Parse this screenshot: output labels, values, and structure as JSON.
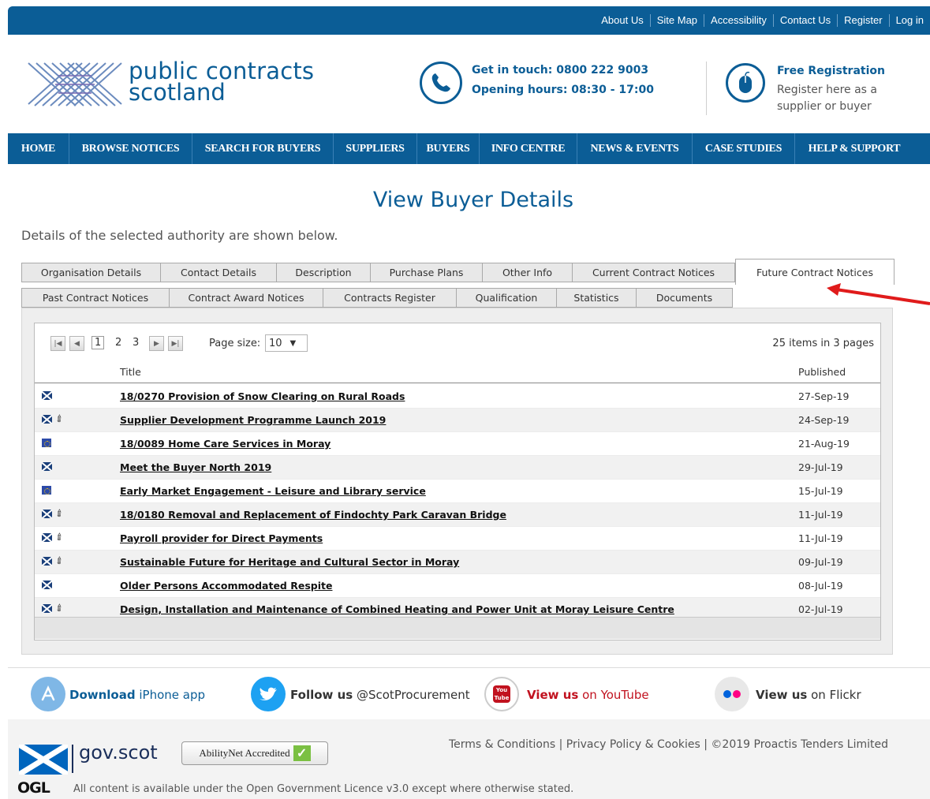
{
  "top_links": [
    "About Us",
    "Site Map",
    "Accessibility",
    "Contact Us",
    "Register",
    "Log in"
  ],
  "logo": {
    "line1": "public contracts",
    "line2": "scotland"
  },
  "contact": {
    "line1": "Get in touch: 0800 222 9003",
    "line2": "Opening hours: 08:30 - 17:00"
  },
  "registration": {
    "title": "Free Registration",
    "line1": "Register here as a",
    "line2": "supplier or buyer"
  },
  "nav": [
    "HOME",
    "BROWSE NOTICES",
    "SEARCH FOR BUYERS",
    "SUPPLIERS",
    "BUYERS",
    "INFO CENTRE",
    "NEWS & EVENTS",
    "CASE STUDIES",
    "HELP & SUPPORT"
  ],
  "page": {
    "title": "View Buyer Details",
    "intro": "Details of the selected authority are shown below."
  },
  "tabs_row1": [
    "Organisation Details",
    "Contact Details",
    "Description",
    "Purchase Plans",
    "Other Info",
    "Current Contract Notices",
    "Future Contract Notices"
  ],
  "tabs_row2": [
    "Past Contract Notices",
    "Contract Award Notices",
    "Contracts Register",
    "Qualification",
    "Statistics",
    "Documents"
  ],
  "active_tab": "Future Contract Notices",
  "pager": {
    "pages": [
      "1",
      "2",
      "3"
    ],
    "current_page": "1",
    "page_size_label": "Page size:",
    "page_size": "10",
    "items_info": "25 items in 3 pages"
  },
  "columns": {
    "title": "Title",
    "published": "Published"
  },
  "notices": [
    {
      "title": "18/0270 Provision of Snow Clearing on Rural Roads",
      "published": "27-Sep-19",
      "flag": "saltire-icon",
      "attachment": false
    },
    {
      "title": "Supplier Development Programme Launch 2019",
      "published": "24-Sep-19",
      "flag": "saltire-icon",
      "attachment": true
    },
    {
      "title": "18/0089 Home Care Services in Moray",
      "published": "21-Aug-19",
      "flag": "eu-flag-icon",
      "attachment": false
    },
    {
      "title": "Meet the Buyer North 2019",
      "published": "29-Jul-19",
      "flag": "saltire-icon",
      "attachment": false
    },
    {
      "title": "Early Market Engagement - Leisure and Library service",
      "published": "15-Jul-19",
      "flag": "eu-flag-icon",
      "attachment": false
    },
    {
      "title": "18/0180 Removal and Replacement of Findochty Park Caravan Bridge",
      "published": "11-Jul-19",
      "flag": "saltire-icon",
      "attachment": true
    },
    {
      "title": "Payroll provider for Direct Payments",
      "published": "11-Jul-19",
      "flag": "saltire-icon",
      "attachment": true
    },
    {
      "title": "Sustainable Future for Heritage and Cultural Sector in Moray",
      "published": "09-Jul-19",
      "flag": "saltire-icon",
      "attachment": true
    },
    {
      "title": "Older Persons Accommodated Respite",
      "published": "08-Jul-19",
      "flag": "saltire-icon",
      "attachment": false
    },
    {
      "title": "Design, Installation and Maintenance of Combined Heating and Power Unit at Moray Leisure Centre",
      "published": "02-Jul-19",
      "flag": "saltire-icon",
      "attachment": true
    }
  ],
  "social": {
    "iphone": {
      "bold": "Download",
      "rest": " iPhone app"
    },
    "twitter": {
      "bold": "Follow us",
      "rest": " @ScotProcurement"
    },
    "youtube": {
      "bold": "View us",
      "rest": " on YouTube",
      "icon_text": "You Tube"
    },
    "flickr": {
      "bold": "View us",
      "rest": " on Flickr"
    }
  },
  "footer": {
    "govscot": "gov.scot",
    "abilitynet": "AbilityNet Accredited",
    "legal": "Terms & Conditions | Privacy Policy & Cookies | ©2019 Proactis Tenders Limited",
    "ogl": "OGL",
    "licence": "All content is available under the Open Government Licence v3.0 except where otherwise stated."
  },
  "colors": {
    "brand_blue": "#0b5d96",
    "arrow_red": "#e01b1b",
    "youtube_red": "#c1121f",
    "twitter_blue": "#1da1f2"
  }
}
